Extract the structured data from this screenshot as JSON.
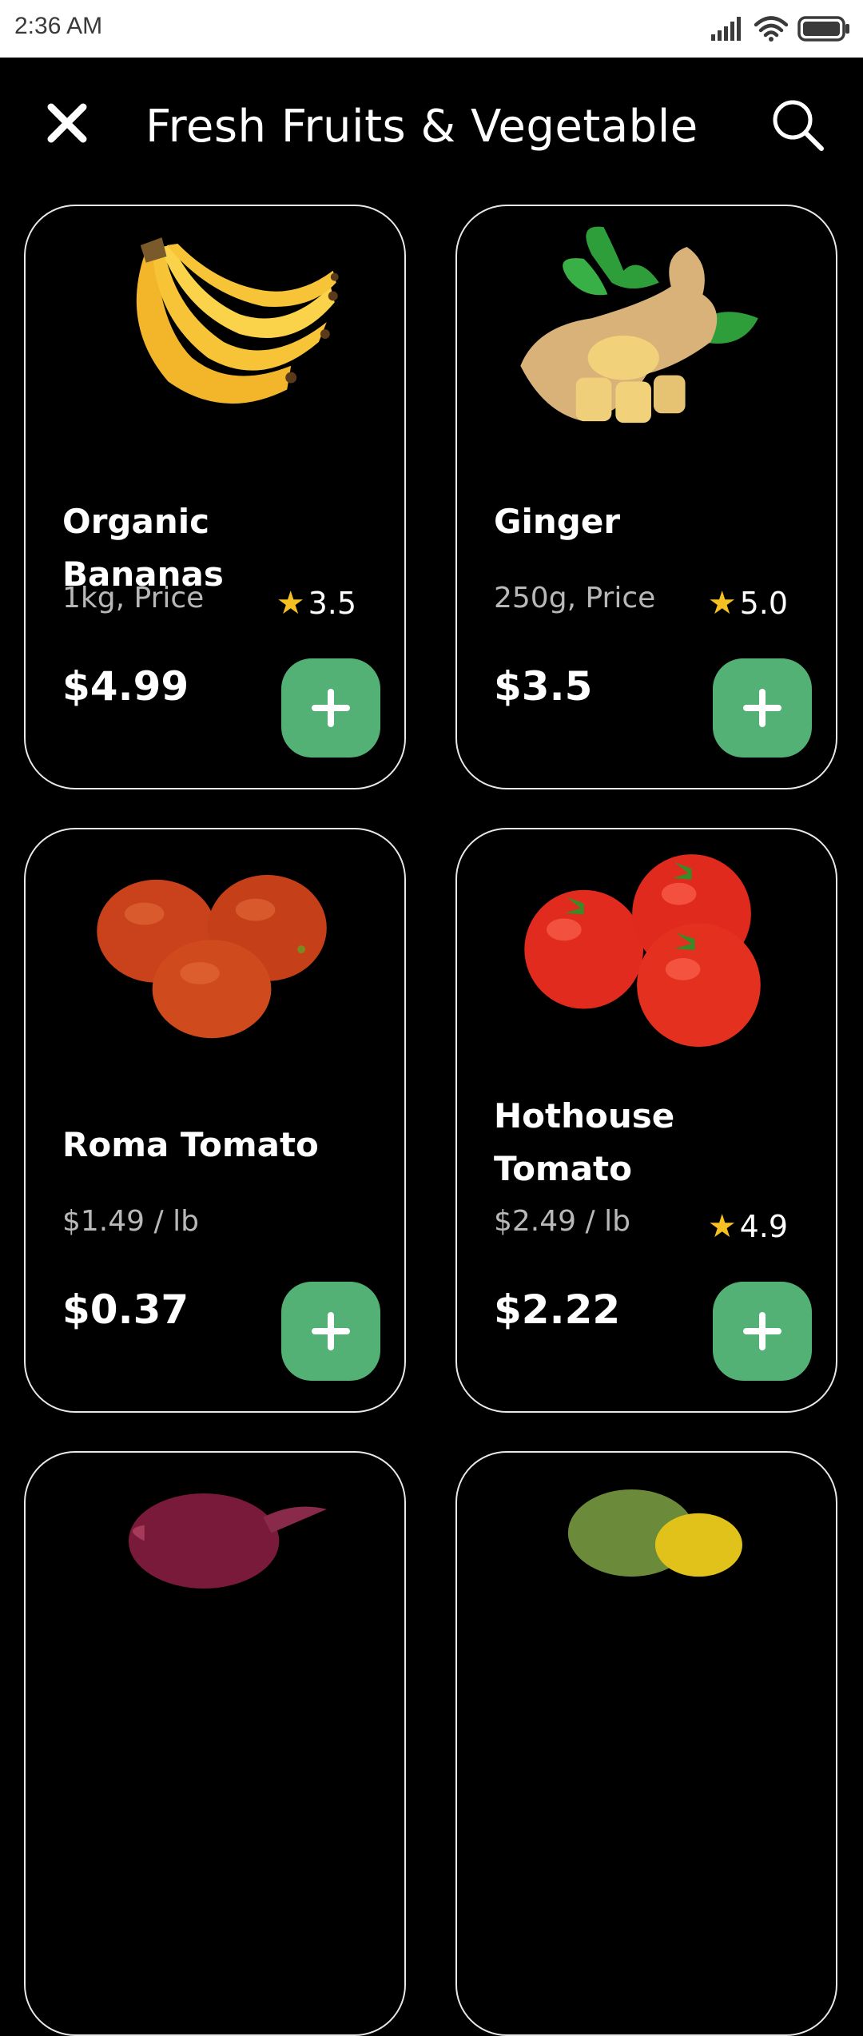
{
  "status_bar": {
    "time": "2:36 AM",
    "icons": [
      "signal-icon",
      "wifi-icon",
      "battery-icon"
    ]
  },
  "header": {
    "title": "Fresh Fruits & Vegetable",
    "close_icon": "close-icon",
    "search_icon": "search-icon"
  },
  "colors": {
    "accent": "#53b175",
    "star": "#f5c022",
    "background": "#000000"
  },
  "products": [
    {
      "name": "Organic Bananas",
      "unit": "1kg, Price",
      "rating": "3.5",
      "price": "$4.99",
      "image": "bananas"
    },
    {
      "name": "Ginger",
      "unit": "250g, Price",
      "rating": "5.0",
      "price": "$3.5",
      "image": "ginger"
    },
    {
      "name": "Roma Tomato",
      "unit": "$1.49 / lb",
      "rating": "",
      "price": "$0.37",
      "image": "roma-tomatoes"
    },
    {
      "name": "Hothouse Tomato",
      "unit": "$2.49 / lb",
      "rating": "4.9",
      "price": "$2.22",
      "image": "hothouse-tomatoes"
    },
    {
      "name": "",
      "unit": "",
      "rating": "",
      "price": "",
      "image": "red-onion"
    },
    {
      "name": "",
      "unit": "",
      "rating": "",
      "price": "",
      "image": "peppers"
    }
  ]
}
